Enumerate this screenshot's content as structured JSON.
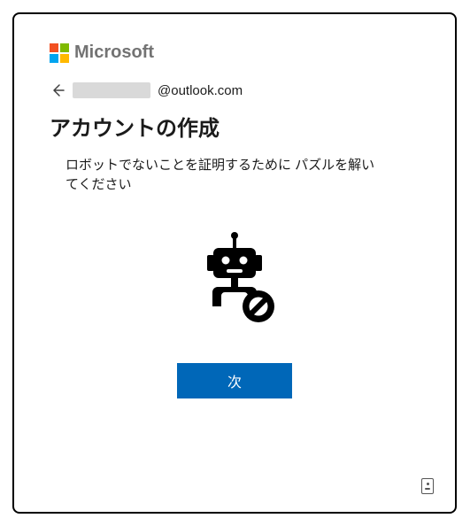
{
  "brand": {
    "name": "Microsoft"
  },
  "email": {
    "domain": "@outlook.com"
  },
  "page": {
    "title": "アカウントの作成",
    "description": "ロボットでないことを証明するために パズルを解いてください"
  },
  "actions": {
    "next_label": "次"
  }
}
